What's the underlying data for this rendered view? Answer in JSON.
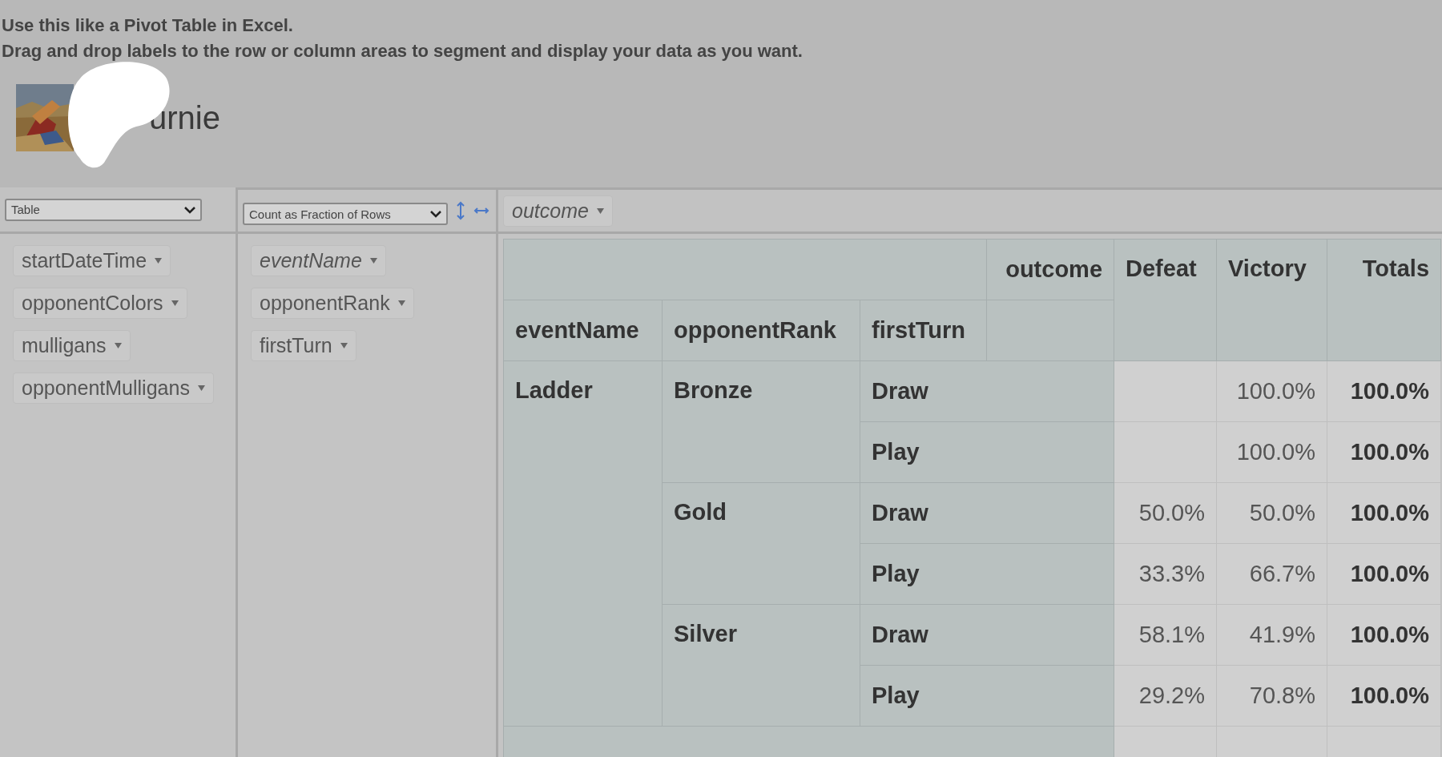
{
  "page": {
    "intro": [
      "Use this like a Pivot Table in Excel.",
      "Drag and drop labels to the row or column areas to segment and display your data as you want."
    ]
  },
  "deck": {
    "name": "urnie"
  },
  "renderer": {
    "value": "Table"
  },
  "aggregator": {
    "value": "Count as Fraction of Rows"
  },
  "unused_fields": [
    {
      "label": "startDateTime",
      "filtered": false
    },
    {
      "label": "opponentColors",
      "filtered": false
    },
    {
      "label": "mulligans",
      "filtered": false
    },
    {
      "label": "opponentMulligans",
      "filtered": false
    }
  ],
  "row_fields": [
    {
      "label": "eventName",
      "filtered": true
    },
    {
      "label": "opponentRank",
      "filtered": false
    },
    {
      "label": "firstTurn",
      "filtered": false
    }
  ],
  "column_fields": [
    {
      "label": "outcome",
      "filtered": true
    }
  ],
  "table": {
    "column_axis": "outcome",
    "row_axes": [
      "eventName",
      "opponentRank",
      "firstTurn"
    ],
    "columns": [
      "Defeat",
      "Victory",
      "Totals"
    ],
    "groups": [
      {
        "label": "Ladder",
        "children": [
          {
            "label": "Bronze",
            "children": [
              {
                "label": "Draw",
                "victory": "100.0%",
                "total": "100.0%"
              },
              {
                "label": "Play",
                "victory": "100.0%",
                "total": "100.0%"
              }
            ]
          },
          {
            "label": "Gold",
            "children": [
              {
                "label": "Draw",
                "defeat": "50.0%",
                "victory": "50.0%",
                "total": "100.0%"
              },
              {
                "label": "Play",
                "defeat": "33.3%",
                "victory": "66.7%",
                "total": "100.0%"
              }
            ]
          },
          {
            "label": "Silver",
            "children": [
              {
                "label": "Draw",
                "defeat": "58.1%",
                "victory": "41.9%",
                "total": "100.0%"
              },
              {
                "label": "Play",
                "defeat": "29.2%",
                "victory": "70.8%",
                "total": "100.0%"
              }
            ]
          }
        ]
      }
    ]
  }
}
